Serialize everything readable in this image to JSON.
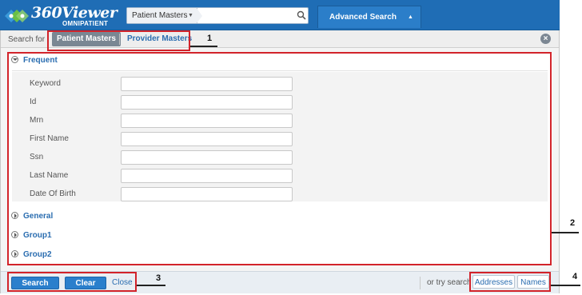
{
  "header": {
    "logo_title": "360Viewer",
    "logo_subtitle": "OMNIPATIENT",
    "search_scope": "Patient Masters",
    "search_value": "",
    "advanced_search_label": "Advanced Search"
  },
  "search_for": {
    "label": "Search for",
    "tabs": [
      "Patient Masters",
      "Provider Masters"
    ],
    "active_tab": "Patient Masters"
  },
  "sections": {
    "frequent": {
      "title": "Frequent",
      "fields": [
        {
          "label": "Keyword",
          "value": ""
        },
        {
          "label": "Id",
          "value": ""
        },
        {
          "label": "Mrn",
          "value": ""
        },
        {
          "label": "First Name",
          "value": ""
        },
        {
          "label": "Ssn",
          "value": ""
        },
        {
          "label": "Last Name",
          "value": ""
        },
        {
          "label": "Date Of Birth",
          "value": ""
        }
      ]
    },
    "collapsed": [
      {
        "title": "General"
      },
      {
        "title": "Group1"
      },
      {
        "title": "Group2"
      }
    ]
  },
  "footer": {
    "search_label": "Search",
    "clear_label": "Clear",
    "close_label": "Close",
    "try_label": "or try search",
    "try_links": [
      "Addresses",
      "Names"
    ]
  },
  "annotations": [
    "1",
    "2",
    "3",
    "4"
  ],
  "colors": {
    "header_bg": "#1f6db5",
    "link": "#2a6db0",
    "button": "#2a7fcc",
    "annotation": "#d2232a"
  },
  "icons": [
    "logo-mark-icon",
    "chevron-down-icon",
    "search-icon",
    "caret-up-icon",
    "close-icon",
    "collapse-icon",
    "expand-icon"
  ]
}
